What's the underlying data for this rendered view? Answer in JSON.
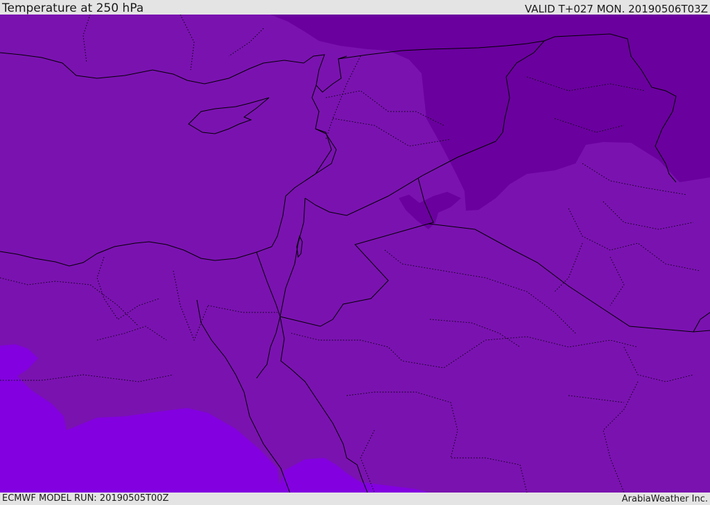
{
  "header": {
    "title": "Temperature at 250 hPa",
    "valid_time": "VALID T+027 MON. 20190506T03Z"
  },
  "footer": {
    "model_run": "ECMWF MODEL RUN: 20190505T00Z",
    "credit": "ArabiaWeather Inc."
  },
  "map": {
    "region": "Eastern Mediterranean and Middle East",
    "field": "temperature",
    "level_hpa": 250,
    "layers": [
      "coastlines",
      "country-borders",
      "province-borders"
    ],
    "colors": {
      "base": "#7a12b0",
      "cold_zone": "#6a009e",
      "warm_zone": "#8300e0",
      "lines": "#000000"
    }
  }
}
